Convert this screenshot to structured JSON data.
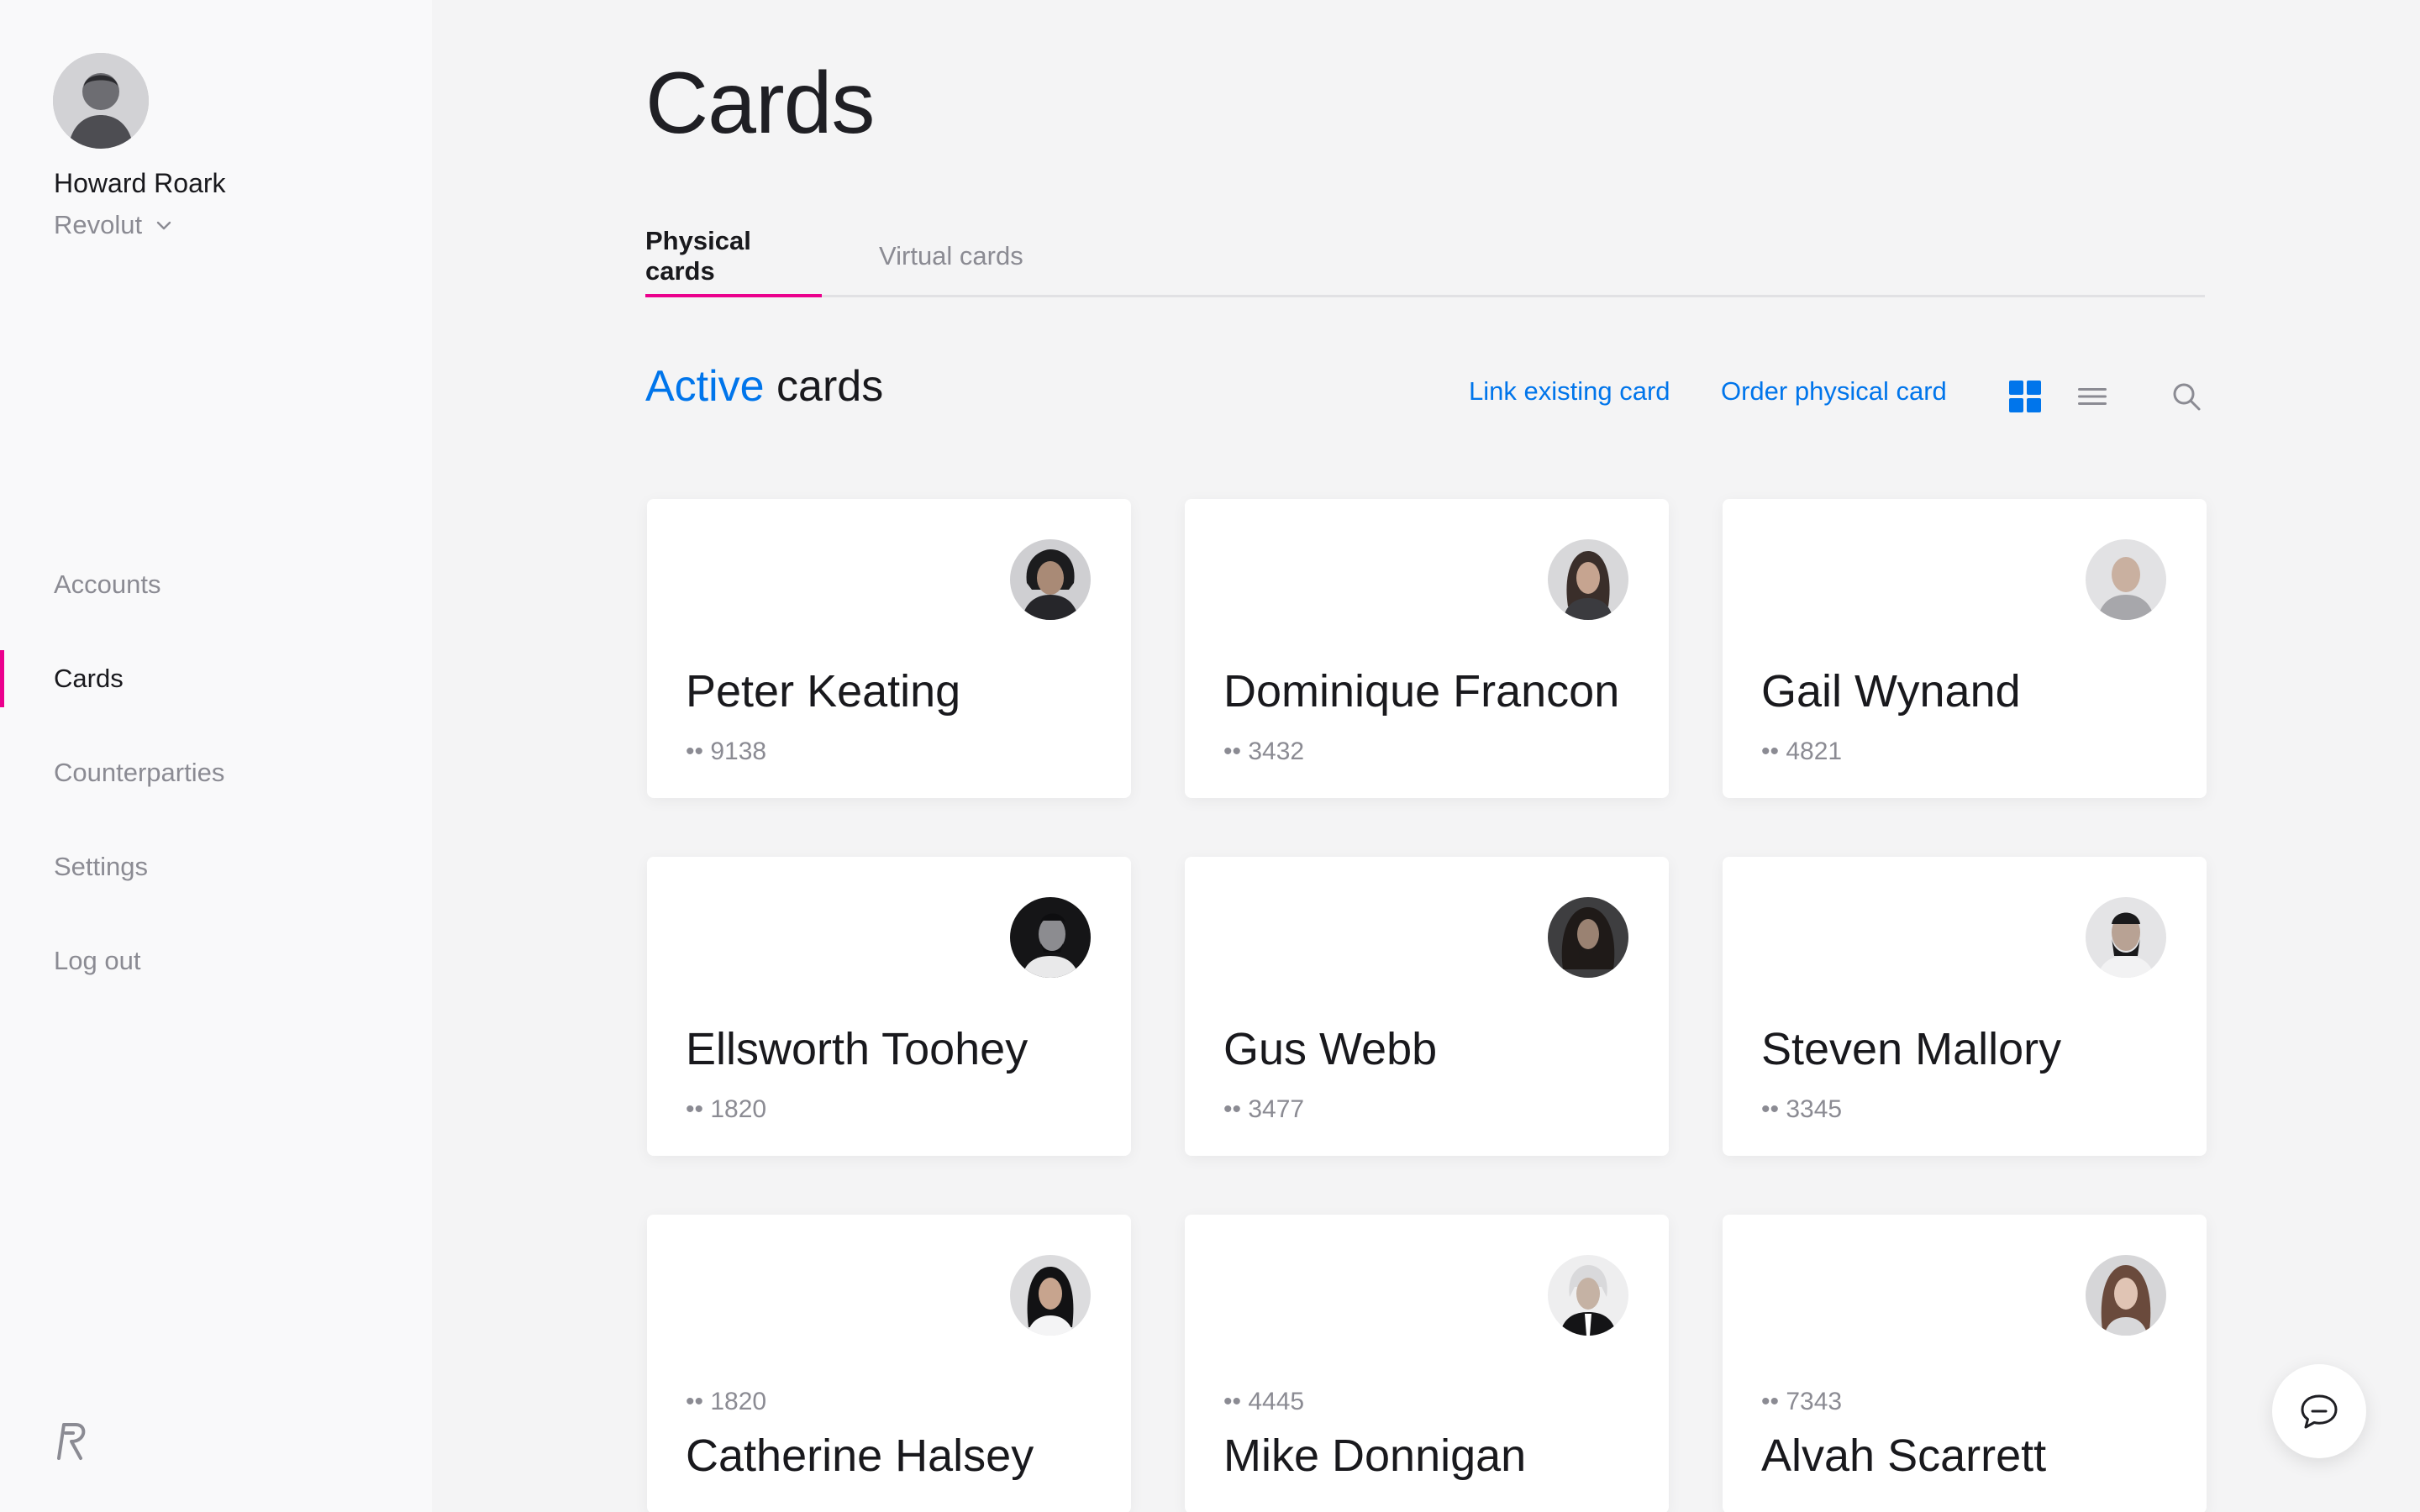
{
  "user": {
    "name": "Howard Roark",
    "organization": "Revolut",
    "avatar_icon": "user-avatar"
  },
  "nav": {
    "items": [
      {
        "label": "Accounts",
        "active": false
      },
      {
        "label": "Cards",
        "active": true
      },
      {
        "label": "Counterparties",
        "active": false
      },
      {
        "label": "Settings",
        "active": false
      },
      {
        "label": "Log out",
        "active": false
      }
    ]
  },
  "page": {
    "title": "Cards"
  },
  "tabs": {
    "physical": "Physical cards",
    "virtual": "Virtual cards",
    "selected": "Physical cards"
  },
  "section": {
    "title_accent": "Active",
    "title_rest": " cards",
    "link_existing": "Link existing card",
    "order_physical": "Order physical card",
    "view_mode": "grid"
  },
  "cards": [
    {
      "holder": "Peter Keating",
      "last4": "•• 9138"
    },
    {
      "holder": "Dominique Francon",
      "last4": "•• 3432"
    },
    {
      "holder": "Gail Wynand",
      "last4": "•• 4821"
    },
    {
      "holder": "Ellsworth Toohey",
      "last4": "•• 1820"
    },
    {
      "holder": "Gus Webb",
      "last4": "•• 3477"
    },
    {
      "holder": "Steven Mallory",
      "last4": "•• 3345"
    },
    {
      "holder": "Catherine Halsey",
      "last4": "•• 1820"
    },
    {
      "holder": "Mike Donnigan",
      "last4": "•• 4445"
    },
    {
      "holder": "Alvah Scarrett",
      "last4": "•• 7343"
    }
  ],
  "colors": {
    "accent": "#0075eb",
    "active_indicator": "#eb008d",
    "muted_text": "#8b8b93"
  }
}
